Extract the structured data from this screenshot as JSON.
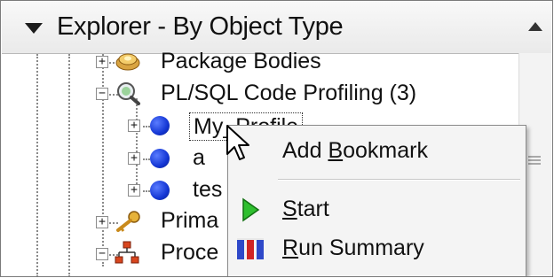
{
  "header": {
    "title": "Explorer - By Object Type"
  },
  "tree": {
    "items": [
      {
        "label": "Package Bodies",
        "expander": "⊞",
        "icon": "package-bodies-icon"
      },
      {
        "label": "PL/SQL Code Profiling (3)",
        "expander": "⊟",
        "icon": "magnifier-icon"
      },
      {
        "label": "My_Profile",
        "expander": "⊞",
        "icon": "profile-dot-icon",
        "selected": true
      },
      {
        "label": "a",
        "expander": "⊞",
        "icon": "profile-dot-icon"
      },
      {
        "label": "tes",
        "expander": "⊞",
        "icon": "profile-dot-icon"
      },
      {
        "label": "Prima",
        "expander": "⊞",
        "icon": "key-icon"
      },
      {
        "label": "Proce",
        "expander": "⊞",
        "icon": "procedure-icon"
      }
    ]
  },
  "context_menu": {
    "items": [
      {
        "pre": "Add ",
        "ul": "B",
        "post": "ookmark",
        "icon": ""
      },
      {
        "pre": "",
        "ul": "S",
        "post": "tart",
        "icon": "play-icon"
      },
      {
        "pre": "",
        "ul": "R",
        "post": "un Summary",
        "icon": "bar-chart-icon"
      }
    ]
  },
  "colors": {
    "header_bg": "#eeeeee",
    "menu_bg": "#f4f4f4",
    "dot_blue": "#1436d4",
    "play_green": "#22a822"
  }
}
